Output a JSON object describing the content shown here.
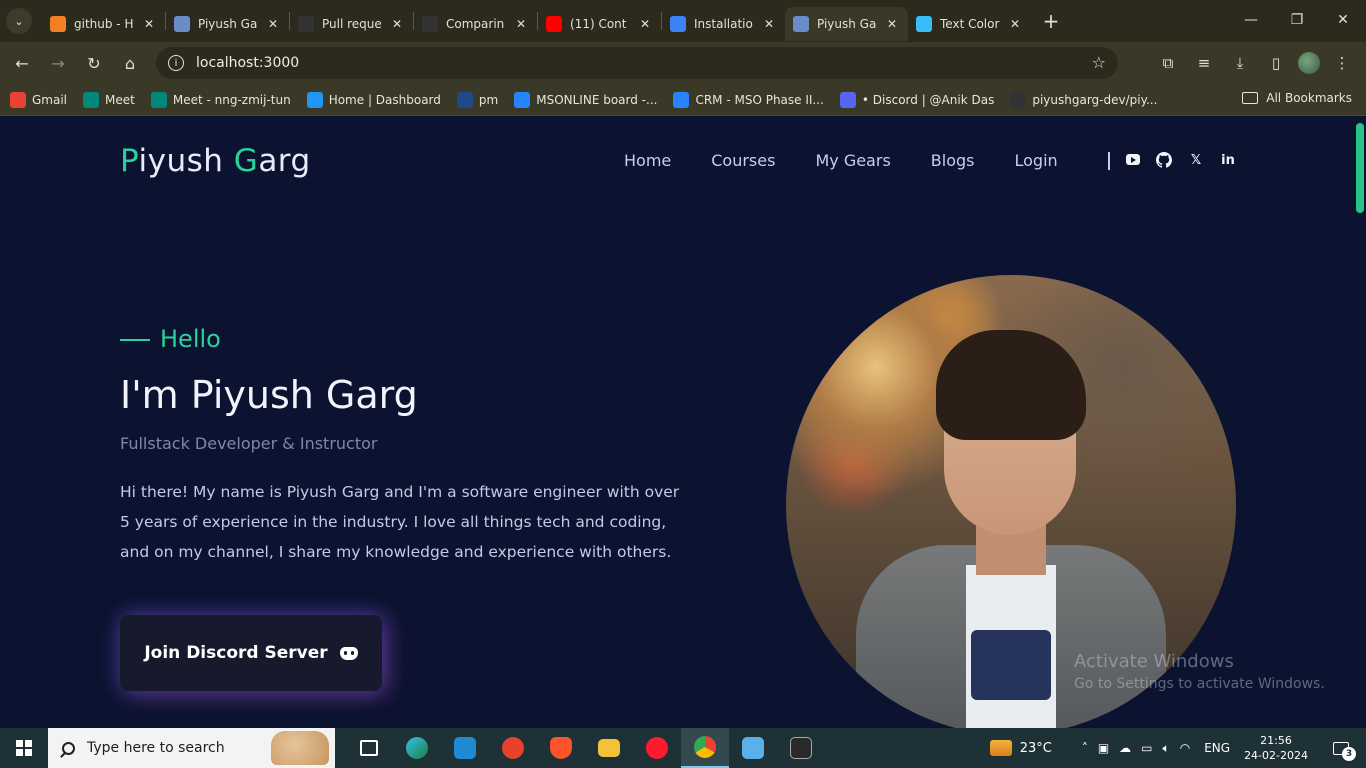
{
  "browser": {
    "tabs": [
      {
        "title": "github - H",
        "icon": "stackoverflow-icon",
        "color": "#f48024",
        "active": false
      },
      {
        "title": "Piyush Ga",
        "icon": "page-icon",
        "color": "#6a8cc8",
        "active": false
      },
      {
        "title": "Pull reque",
        "icon": "github-icon",
        "color": "#333333",
        "active": false
      },
      {
        "title": "Comparin",
        "icon": "github-icon",
        "color": "#333333",
        "active": false
      },
      {
        "title": "(11) Cont",
        "icon": "youtube-icon",
        "color": "#ff0000",
        "active": false
      },
      {
        "title": "Installatio",
        "icon": "docs-icon",
        "color": "#3b82f6",
        "active": false
      },
      {
        "title": "Piyush Ga",
        "icon": "page-icon",
        "color": "#6a8cc8",
        "active": true
      },
      {
        "title": "Text Color",
        "icon": "tailwind-icon",
        "color": "#38bdf8",
        "active": false
      }
    ],
    "url": "localhost:3000",
    "bookmarks": [
      {
        "label": "Gmail",
        "icon": "gmail-icon",
        "color": "#ea4335"
      },
      {
        "label": "Meet",
        "icon": "meet-icon",
        "color": "#00897b"
      },
      {
        "label": "Meet - nng-zmij-tun",
        "icon": "meet-icon",
        "color": "#00897b"
      },
      {
        "label": "Home | Dashboard",
        "icon": "k-icon",
        "color": "#2196f3"
      },
      {
        "label": "pm",
        "icon": "globe-icon",
        "color": "#1e4a8a"
      },
      {
        "label": "MSONLINE board -...",
        "icon": "jira-icon",
        "color": "#2684ff"
      },
      {
        "label": "CRM - MSO Phase II...",
        "icon": "confluence-icon",
        "color": "#2684ff"
      },
      {
        "label": "• Discord | @Anik Das",
        "icon": "discord-icon",
        "color": "#5865f2"
      },
      {
        "label": "piyushgarg-dev/piy...",
        "icon": "github-icon",
        "color": "#333333"
      }
    ],
    "all_bookmarks": "All Bookmarks"
  },
  "site": {
    "logo_first": "P",
    "logo_mid1": "iyush ",
    "logo_g": "G",
    "logo_rest": "arg",
    "nav": [
      "Home",
      "Courses",
      "My Gears",
      "Blogs",
      "Login"
    ],
    "socials": [
      "youtube-icon",
      "github-icon",
      "x-icon",
      "linkedin-icon"
    ],
    "hello": "Hello",
    "headline": "I'm Piyush Garg",
    "subtitle": "Fullstack Developer & Instructor",
    "intro": "Hi there! My name is Piyush Garg and I'm a software engineer with over 5 years of experience in the industry. I love all things tech and coding, and on my channel, I share my knowledge and experience with others.",
    "cta": "Join Discord Server",
    "accent": "#2ad19a"
  },
  "watermark": {
    "line1": "Activate Windows",
    "line2": "Go to Settings to activate Windows."
  },
  "taskbar": {
    "search_placeholder": "Type here to search",
    "temperature": "23°C",
    "language": "ENG",
    "time": "21:56",
    "date": "24-02-2024",
    "notifications": "3"
  }
}
